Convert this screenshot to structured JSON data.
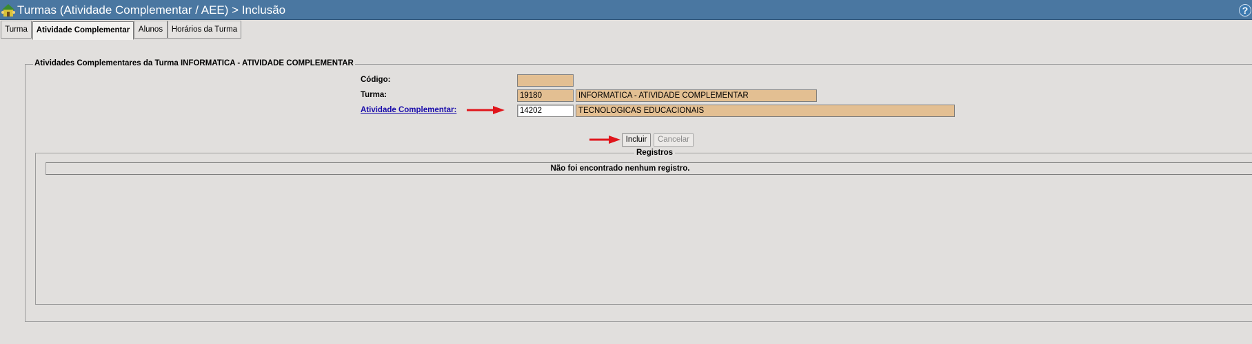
{
  "header": {
    "title": "Turmas (Atividade Complementar / AEE) > Inclusão",
    "help_glyph": "?",
    "app_icon": "house-people-icon",
    "help_icon": "help-icon"
  },
  "tabs": [
    {
      "label": "Turma",
      "active": false
    },
    {
      "label": "Atividade Complementar",
      "active": true
    },
    {
      "label": "Alunos",
      "active": false
    },
    {
      "label": "Horários da Turma",
      "active": false
    }
  ],
  "form": {
    "legend": "Atividades Complementares da Turma INFORMATICA - ATIVIDADE COMPLEMENTAR",
    "codigo_label": "Código:",
    "codigo_value": "",
    "turma_label": "Turma:",
    "turma_code": "19180",
    "turma_name": "INFORMATICA - ATIVIDADE COMPLEMENTAR",
    "atividade_label": "Atividade Complementar:",
    "atividade_code": "14202",
    "atividade_name": "TECNOLOGICAS EDUCACIONAIS"
  },
  "actions": {
    "incluir_label": "Incluir",
    "cancelar_label": "Cancelar"
  },
  "registros": {
    "title": "Registros",
    "empty_message": "Não foi encontrado nenhum registro."
  },
  "colors": {
    "titlebar": "#4a77a1",
    "readonly_field": "#e3bf92",
    "arrow": "#e0151b",
    "link": "#1a0dab"
  }
}
